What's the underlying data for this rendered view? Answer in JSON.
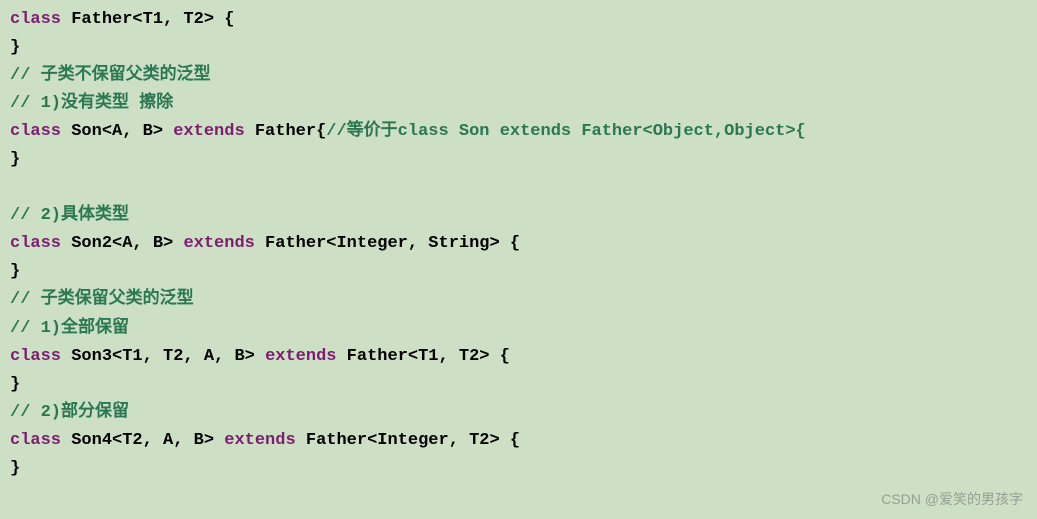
{
  "lines": [
    {
      "segments": [
        {
          "cls": "keyword",
          "text": "class"
        },
        {
          "cls": "",
          "text": " Father<T1, T2> {"
        }
      ]
    },
    {
      "segments": [
        {
          "cls": "",
          "text": "}"
        }
      ]
    },
    {
      "segments": [
        {
          "cls": "comment",
          "text": "// 子类不保留父类的泛型"
        }
      ]
    },
    {
      "segments": [
        {
          "cls": "comment",
          "text": "// 1)没有类型 擦除"
        }
      ]
    },
    {
      "segments": [
        {
          "cls": "keyword",
          "text": "class"
        },
        {
          "cls": "",
          "text": " Son<A, B> "
        },
        {
          "cls": "keyword",
          "text": "extends"
        },
        {
          "cls": "",
          "text": " Father{"
        },
        {
          "cls": "comment",
          "text": "//等价于class Son extends Father<Object,Object>{"
        }
      ]
    },
    {
      "segments": [
        {
          "cls": "",
          "text": "}"
        }
      ]
    },
    {
      "segments": [
        {
          "cls": "",
          "text": " "
        }
      ]
    },
    {
      "segments": [
        {
          "cls": "comment",
          "text": "// 2)具体类型"
        }
      ]
    },
    {
      "segments": [
        {
          "cls": "keyword",
          "text": "class"
        },
        {
          "cls": "",
          "text": " Son2<A, B> "
        },
        {
          "cls": "keyword",
          "text": "extends"
        },
        {
          "cls": "",
          "text": " Father<Integer, String> {"
        }
      ]
    },
    {
      "segments": [
        {
          "cls": "",
          "text": "}"
        }
      ]
    },
    {
      "segments": [
        {
          "cls": "comment",
          "text": "// 子类保留父类的泛型"
        }
      ]
    },
    {
      "segments": [
        {
          "cls": "comment",
          "text": "// 1)全部保留"
        }
      ]
    },
    {
      "segments": [
        {
          "cls": "keyword",
          "text": "class"
        },
        {
          "cls": "",
          "text": " Son3<T1, T2, A, B> "
        },
        {
          "cls": "keyword",
          "text": "extends"
        },
        {
          "cls": "",
          "text": " Father<T1, T2> {"
        }
      ]
    },
    {
      "segments": [
        {
          "cls": "",
          "text": "}"
        }
      ]
    },
    {
      "segments": [
        {
          "cls": "comment",
          "text": "// 2)部分保留"
        }
      ]
    },
    {
      "segments": [
        {
          "cls": "keyword",
          "text": "class"
        },
        {
          "cls": "",
          "text": " Son4<T2, A, B> "
        },
        {
          "cls": "keyword",
          "text": "extends"
        },
        {
          "cls": "",
          "text": " Father<Integer, T2> {"
        }
      ]
    },
    {
      "segments": [
        {
          "cls": "",
          "text": "}"
        }
      ]
    }
  ],
  "watermark": "CSDN @爱笑的男孩字"
}
